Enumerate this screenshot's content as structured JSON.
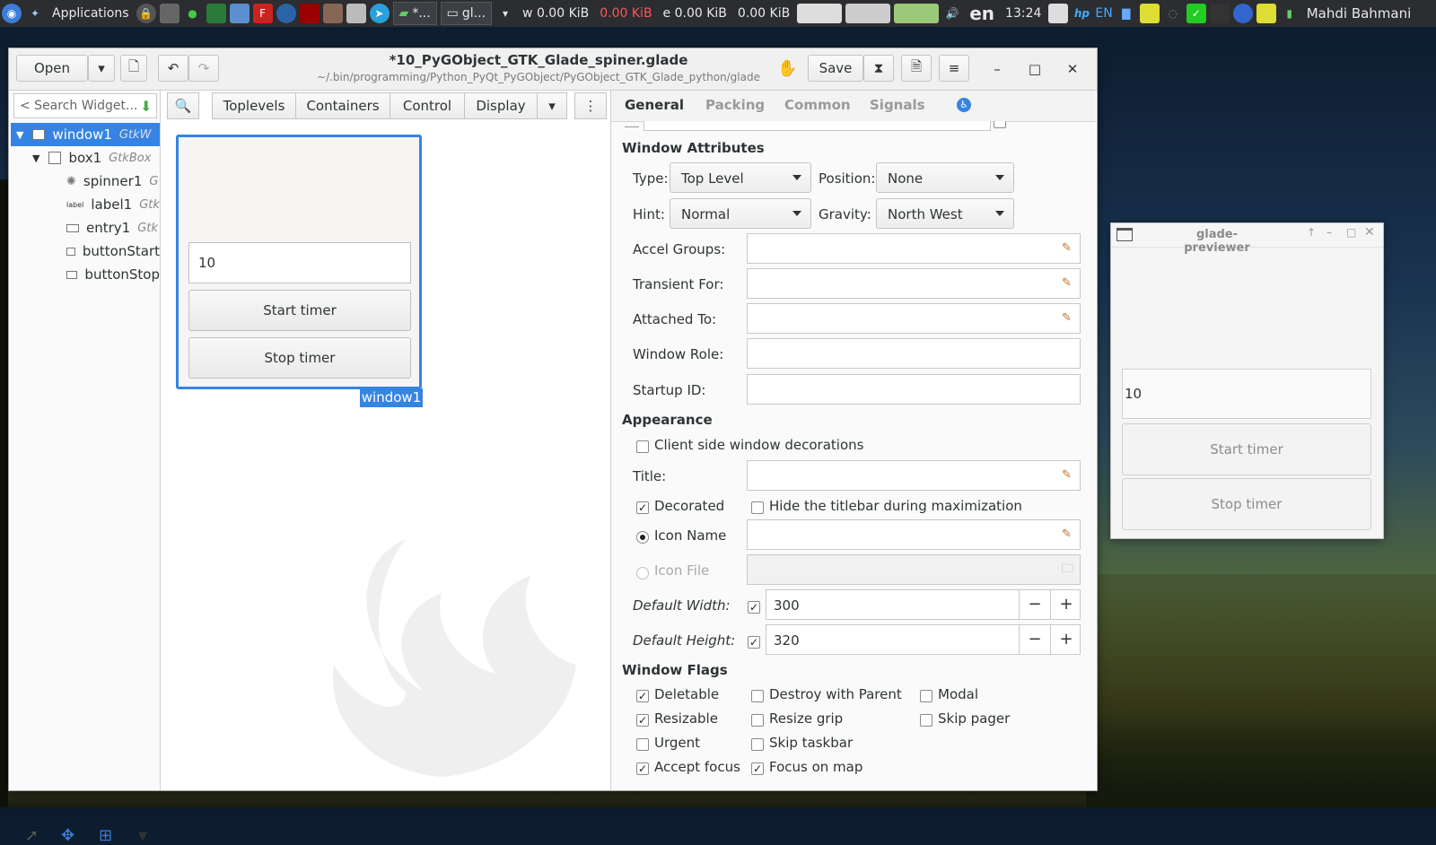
{
  "taskbar": {
    "applications": "Applications",
    "task1": "*...",
    "task2": "gl...",
    "net_w": "w 0.00 KiB",
    "net_r": "0.00 KiB",
    "net_e": "e 0.00 KiB",
    "net_x": "0.00 KiB",
    "lang": "en",
    "time": "13:24",
    "kb": "EN",
    "user": "Mahdi Bahmani"
  },
  "glade": {
    "open": "Open",
    "save": "Save",
    "title": "*10_PyGObject_GTK_Glade_spiner.glade",
    "path": "~/.bin/programming/Python_PyQt_PyGObject/PyGObject_GTK_Glade_python/glade",
    "search_placeholder": "< Search Widget...",
    "tree": [
      {
        "name": "window1",
        "cls": "GtkW"
      },
      {
        "name": "box1",
        "cls": "GtkBox"
      },
      {
        "name": "spinner1",
        "cls": "G"
      },
      {
        "name": "label1",
        "cls": "Gtk"
      },
      {
        "name": "entry1",
        "cls": "Gtk"
      },
      {
        "name": "buttonStart",
        "cls": ""
      },
      {
        "name": "buttonStop",
        "cls": ""
      }
    ],
    "palette": [
      "Toplevels",
      "Containers",
      "Control",
      "Display"
    ],
    "design": {
      "entry": "10",
      "start": "Start timer",
      "stop": "Stop timer",
      "label": "window1"
    },
    "tabs": [
      "General",
      "Packing",
      "Common",
      "Signals"
    ],
    "sections": {
      "attrs": "Window Attributes",
      "appearance": "Appearance",
      "flags": "Window Flags"
    },
    "props": {
      "type_label": "Type:",
      "type_value": "Top Level",
      "position_label": "Position:",
      "position_value": "None",
      "hint_label": "Hint:",
      "hint_value": "Normal",
      "gravity_label": "Gravity:",
      "gravity_value": "North West",
      "accel": "Accel Groups:",
      "transient": "Transient For:",
      "attached": "Attached To:",
      "role": "Window Role:",
      "startup": "Startup ID:",
      "csd": "Client side window decorations",
      "title": "Title:",
      "decorated": "Decorated",
      "hide_titlebar": "Hide the titlebar during maximization",
      "icon_name": "Icon Name",
      "icon_file": "Icon File",
      "def_width": "Default Width:",
      "def_width_value": "300",
      "def_height": "Default Height:",
      "def_height_value": "320"
    },
    "flags": {
      "deletable": "Deletable",
      "destroy": "Destroy with Parent",
      "modal": "Modal",
      "resizable": "Resizable",
      "resize_grip": "Resize grip",
      "skip_pager": "Skip pager",
      "urgent": "Urgent",
      "skip_taskbar": "Skip taskbar",
      "accept_focus": "Accept focus",
      "focus_map": "Focus on map"
    }
  },
  "preview": {
    "title": "glade-previewer",
    "entry": "10",
    "start": "Start timer",
    "stop": "Stop timer"
  }
}
